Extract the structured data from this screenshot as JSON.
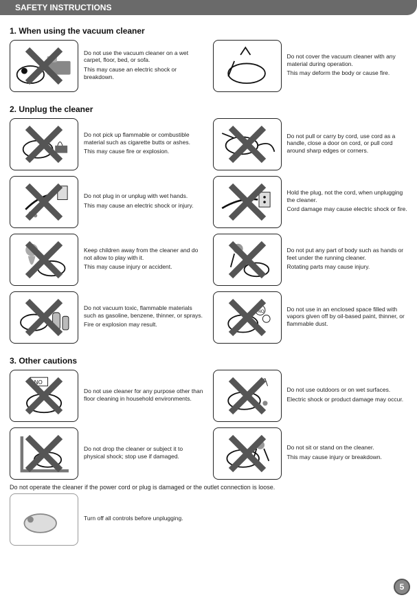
{
  "header": {
    "title": "SAFETY INSTRUCTIONS"
  },
  "page": "5",
  "sections": [
    {
      "title": "1. When using the vacuum cleaner",
      "rows": [
        {
          "left": {
            "thumb": "bed",
            "x": true,
            "p1": "Do not use the vacuum cleaner on a wet carpet, floor, bed, or sofa.",
            "p2": "This may cause an electric shock or breakdown."
          },
          "right": {
            "thumb": "brush",
            "x": false,
            "p1": "Do not cover the vacuum cleaner with any material during operation.",
            "p2": "This may deform the body or cause fire."
          }
        }
      ]
    },
    {
      "title": "2. Unplug the cleaner",
      "rows": [
        {
          "left": {
            "thumb": "fire",
            "x": true,
            "p1": "Do not pick up flammable or combustible material such as cigarette butts or ashes.",
            "p2": "This may cause fire or explosion."
          },
          "right": {
            "thumb": "cord",
            "x": true,
            "p1": "Do not pull or carry by cord, use cord as a handle, close a door on cord, or pull cord around sharp edges or corners.",
            "p2": ""
          }
        },
        {
          "left": {
            "thumb": "wethand",
            "x": true,
            "p1": "Do not plug in or unplug with wet hands.",
            "p2": "This may cause an electric shock or injury."
          },
          "right": {
            "thumb": "outlet",
            "x": true,
            "p1": "Hold the plug, not the cord, when unplugging the cleaner.",
            "p2": "Cord damage may cause electric shock or fire."
          }
        },
        {
          "left": {
            "thumb": "child",
            "x": true,
            "p1": "Keep children away from the cleaner and do not allow to play with it.",
            "p2": "This may cause injury or accident."
          },
          "right": {
            "thumb": "chase",
            "x": true,
            "p1": "Do not put any part of body such as hands or feet under the running cleaner.",
            "p2": "Rotating parts may cause injury."
          }
        },
        {
          "left": {
            "thumb": "spray",
            "x": true,
            "p1": "Do not vacuum toxic, flammable materials such as gasoline, benzene, thinner, or sprays.",
            "p2": "Fire or explosion may result."
          },
          "right": {
            "thumb": "gas",
            "x": true,
            "p1": "Do not use in an enclosed space filled with vapors given off by oil-based paint, thinner, or flammable dust.",
            "p2": ""
          }
        }
      ]
    },
    {
      "title": "3. Other cautions",
      "rows": [
        {
          "left": {
            "thumb": "nolabel",
            "x": true,
            "p1": "Do not use cleaner for any purpose other than floor cleaning in household environments.",
            "p2": ""
          },
          "right": {
            "thumb": "outdoor",
            "x": true,
            "p1": "Do not use outdoors or on wet surfaces.",
            "p2": "Electric shock or product damage may occur."
          }
        },
        {
          "left": {
            "thumb": "drop",
            "x": true,
            "p1": "Do not drop the cleaner or subject it to physical shock; stop use if damaged.",
            "p2": ""
          },
          "right": {
            "thumb": "ride",
            "x": true,
            "p1": "Do not sit or stand on the cleaner.",
            "p2": "This may cause injury or breakdown."
          }
        }
      ]
    }
  ],
  "footnote": "Do not operate the cleaner if the power cord or plug is damaged or the outlet connection is loose.",
  "singles": [
    {
      "thumb": "single",
      "x": false,
      "p1": "Turn off all controls before unplugging.",
      "p2": ""
    }
  ]
}
